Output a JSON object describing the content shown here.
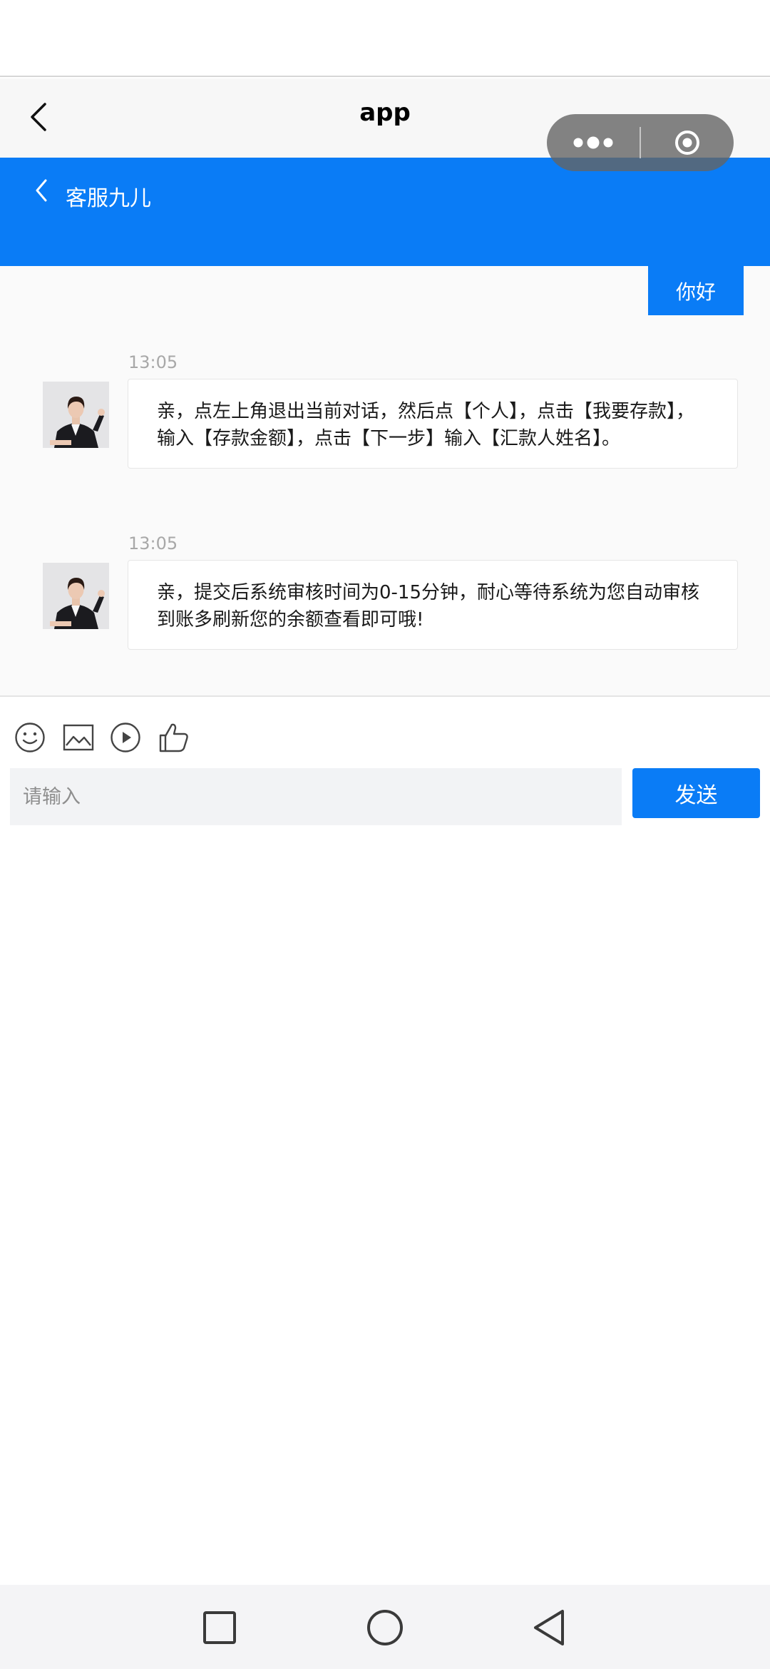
{
  "mini_program": {
    "title": "app",
    "back_icon": "chevron-left-icon",
    "capsule": {
      "more_icon": "more-dots-icon",
      "close_icon": "target-close-icon"
    }
  },
  "chat_header": {
    "title": "客服九儿",
    "back_icon": "chevron-left-icon",
    "color": "#0a7cf6"
  },
  "messages": [
    {
      "side": "right",
      "text": "你好"
    },
    {
      "side": "left",
      "time": "13:05",
      "text": "亲，点左上角退出当前对话，然后点【个人】，点击【我要存款】，输入【存款金额】，点击【下一步】输入【汇款人姓名】。"
    },
    {
      "side": "left",
      "time": "13:05",
      "text": "亲，提交后系统审核时间为0-15分钟，耐心等待系统为您自动审核到账多刷新您的余额查看即可哦!"
    }
  ],
  "toolbar": {
    "icons": [
      "emoji-icon",
      "image-icon",
      "video-play-icon",
      "thumbs-up-icon"
    ]
  },
  "composer": {
    "placeholder": "请输入",
    "send_label": "发送"
  },
  "system_nav": {
    "icons": [
      "recent-apps-square-icon",
      "home-circle-icon",
      "back-triangle-icon"
    ]
  }
}
